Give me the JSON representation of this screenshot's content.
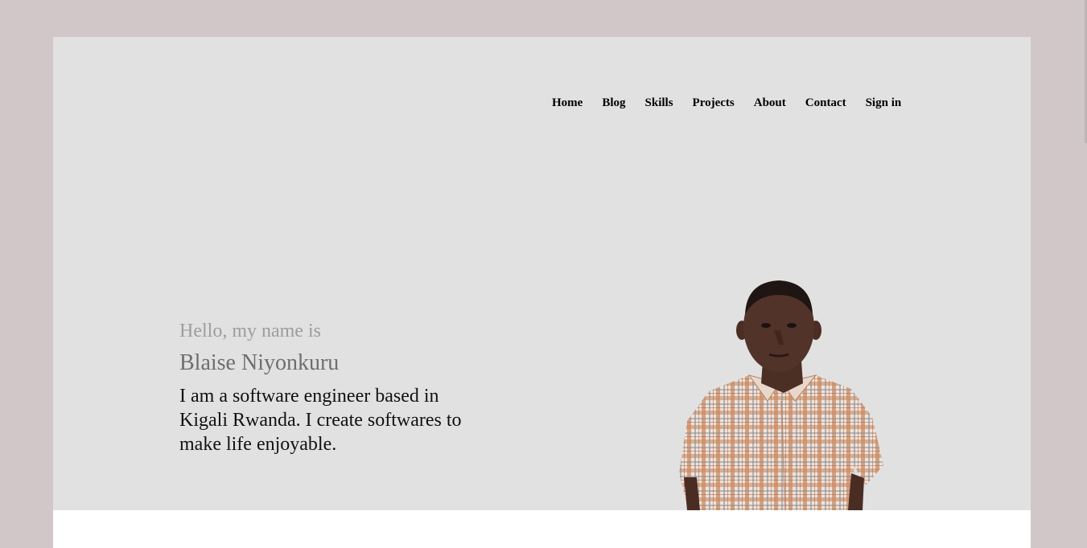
{
  "nav": {
    "items": [
      {
        "label": "Home"
      },
      {
        "label": "Blog"
      },
      {
        "label": "Skills"
      },
      {
        "label": "Projects"
      },
      {
        "label": "About"
      },
      {
        "label": "Contact"
      },
      {
        "label": "Sign in"
      }
    ]
  },
  "hero": {
    "greeting": "Hello, my name is",
    "name": "Blaise Niyonkuru",
    "bio": "I am a software engineer based in Kigali Rwanda. I create softwares to make life enjoyable."
  },
  "colors": {
    "page_background": "#d1c7c8",
    "hero_background": "#e2e1e1",
    "greeting_text": "#9d9d9d",
    "name_text": "#6e6e6e"
  }
}
